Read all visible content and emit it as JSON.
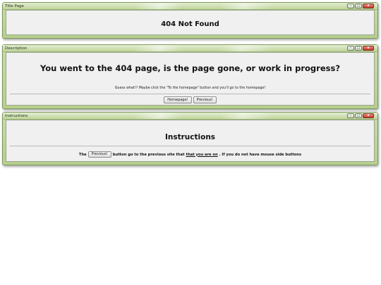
{
  "window1": {
    "title": "Title Page",
    "heading": "404 Not Found"
  },
  "window2": {
    "title": "Description",
    "heading": "You went to the 404 page, is the page gone, or work in progress?",
    "hint": "Guess what!? Maybe click the \"To the homepage\" button and you'll go to the homepage!",
    "homepage_button": "Homepage!",
    "previous_button": "Previous!"
  },
  "window3": {
    "title": "Instructions",
    "heading": "Instructions",
    "text_before": "The",
    "previous_button": "Previous!",
    "text_mid": "button go to the previous site that",
    "text_underlined": "that you are on",
    "text_after": ". If you do not have mouse side buttons"
  },
  "window_controls": {
    "minimize": "–",
    "maximize": "□",
    "close": "x"
  }
}
